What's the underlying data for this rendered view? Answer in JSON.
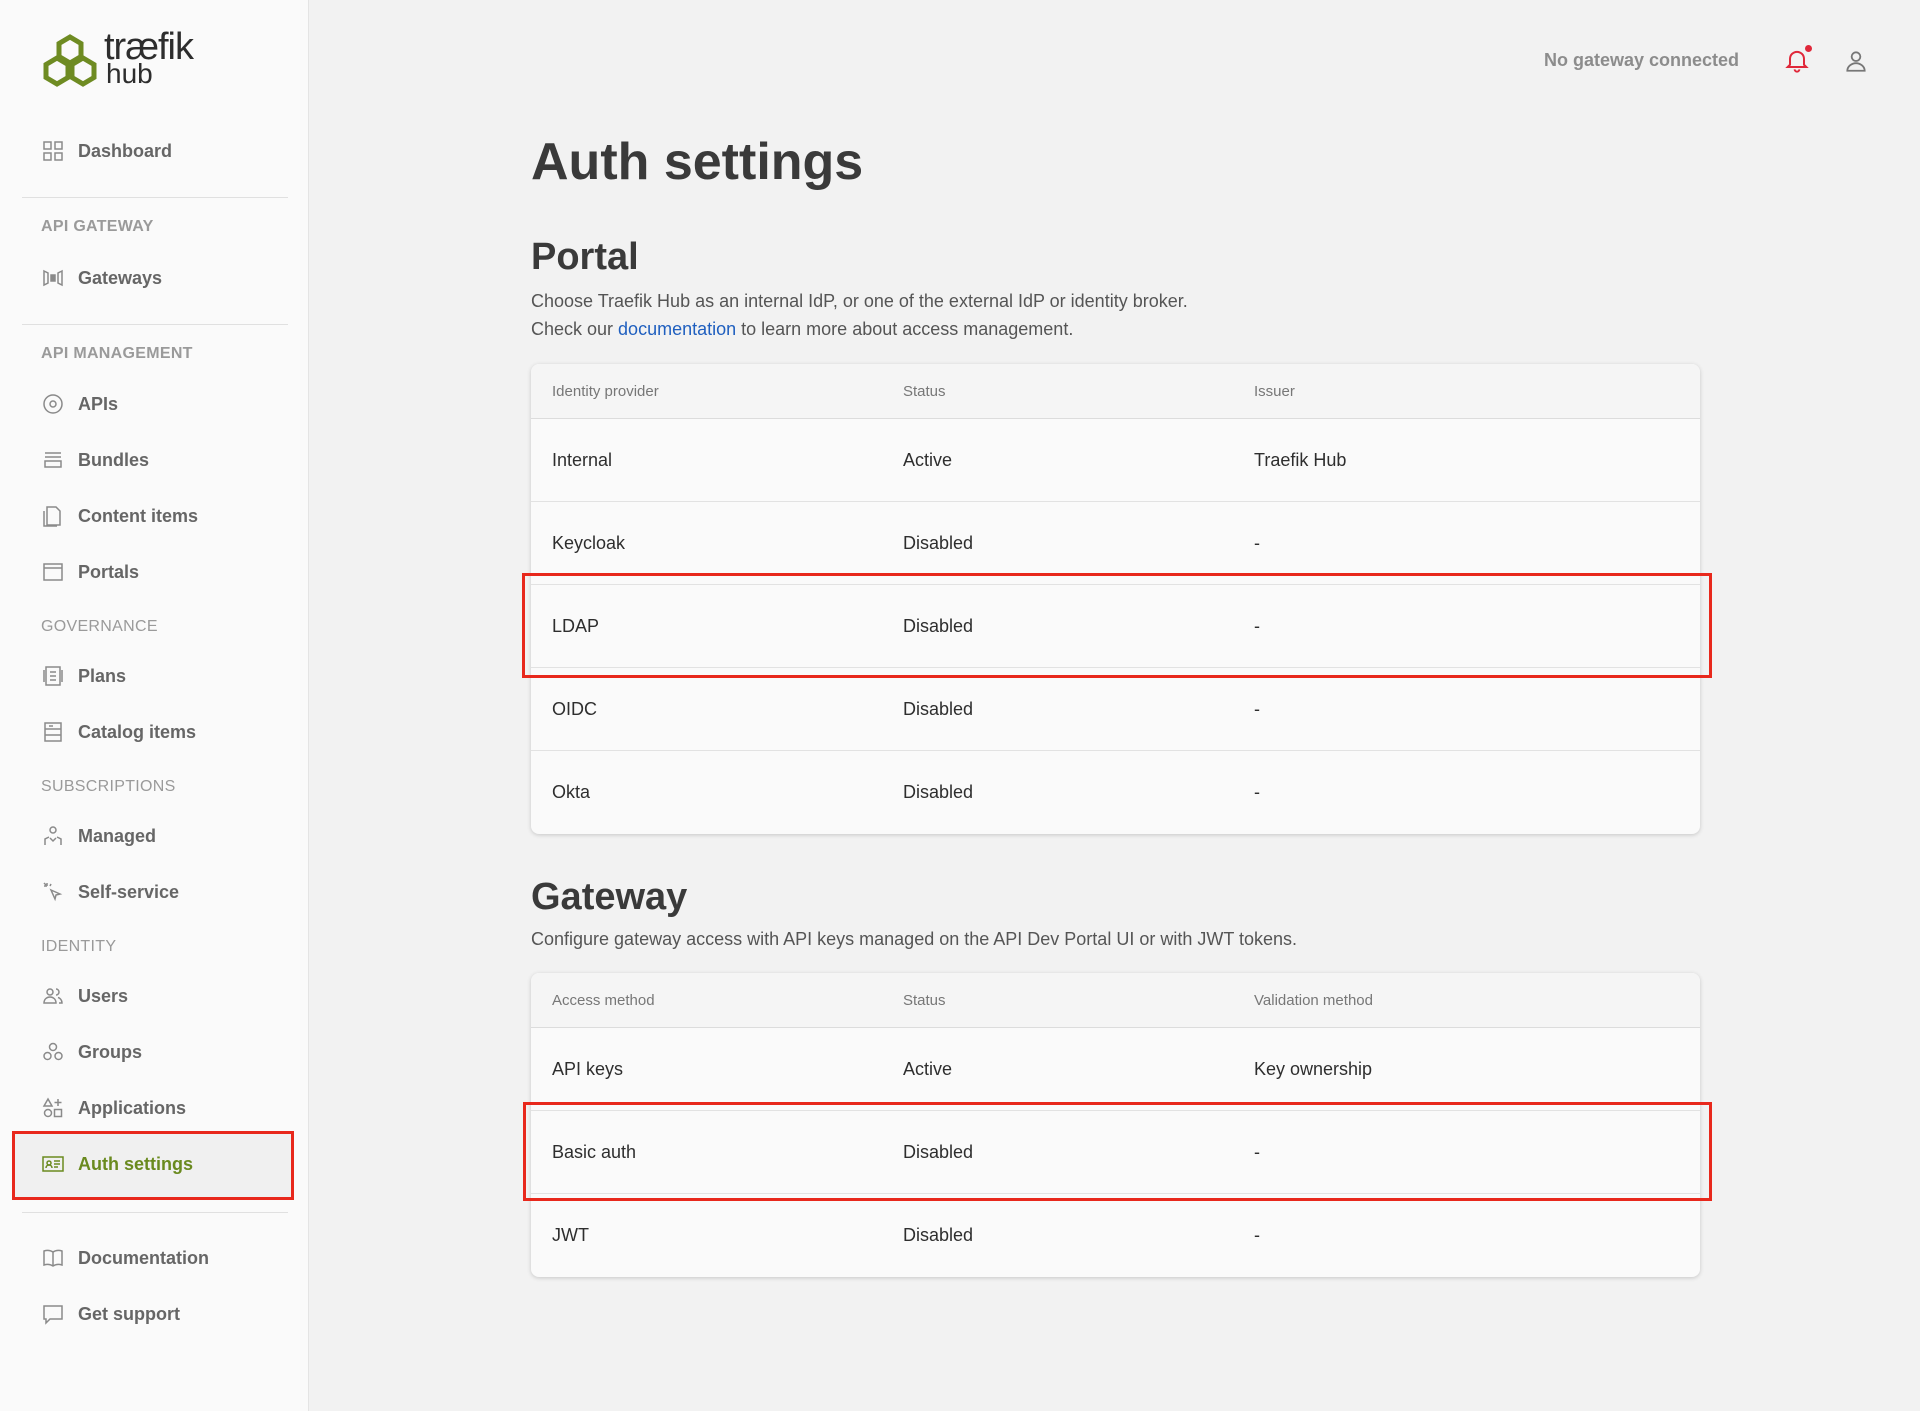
{
  "brand": {
    "name": "træfik",
    "sub": "hub"
  },
  "sidebar": {
    "dashboard": "Dashboard",
    "sections": {
      "api_gateway": "API GATEWAY",
      "api_management": "API MANAGEMENT",
      "governance": "GOVERNANCE",
      "subscriptions": "SUBSCRIPTIONS",
      "identity": "IDENTITY"
    },
    "items": {
      "gateways": "Gateways",
      "apis": "APIs",
      "bundles": "Bundles",
      "content_items": "Content items",
      "portals": "Portals",
      "plans": "Plans",
      "catalog_items": "Catalog items",
      "managed": "Managed",
      "self_service": "Self-service",
      "users": "Users",
      "groups": "Groups",
      "applications": "Applications",
      "auth_settings": "Auth settings",
      "documentation": "Documentation",
      "get_support": "Get support"
    }
  },
  "header": {
    "gateway_status": "No gateway connected"
  },
  "page": {
    "title": "Auth settings",
    "portal": {
      "title": "Portal",
      "desc_line1": "Choose Traefik Hub as an internal IdP, or one of the external IdP or identity broker.",
      "desc_prefix": "Check our ",
      "desc_link": "documentation",
      "desc_suffix": " to learn more about access management.",
      "columns": [
        "Identity provider",
        "Status",
        "Issuer"
      ],
      "rows": [
        [
          "Internal",
          "Active",
          "Traefik Hub"
        ],
        [
          "Keycloak",
          "Disabled",
          "-"
        ],
        [
          "LDAP",
          "Disabled",
          "-"
        ],
        [
          "OIDC",
          "Disabled",
          "-"
        ],
        [
          "Okta",
          "Disabled",
          "-"
        ]
      ]
    },
    "gateway": {
      "title": "Gateway",
      "desc": "Configure gateway access with API keys managed on the API Dev Portal UI or with JWT tokens.",
      "columns": [
        "Access method",
        "Status",
        "Validation method"
      ],
      "rows": [
        [
          "API keys",
          "Active",
          "Key ownership"
        ],
        [
          "Basic auth",
          "Disabled",
          "-"
        ],
        [
          "JWT",
          "Disabled",
          "-"
        ]
      ]
    }
  },
  "colors": {
    "accent": "#6a8a1f",
    "highlight": "#e8281c",
    "link": "#1f5fbf"
  }
}
